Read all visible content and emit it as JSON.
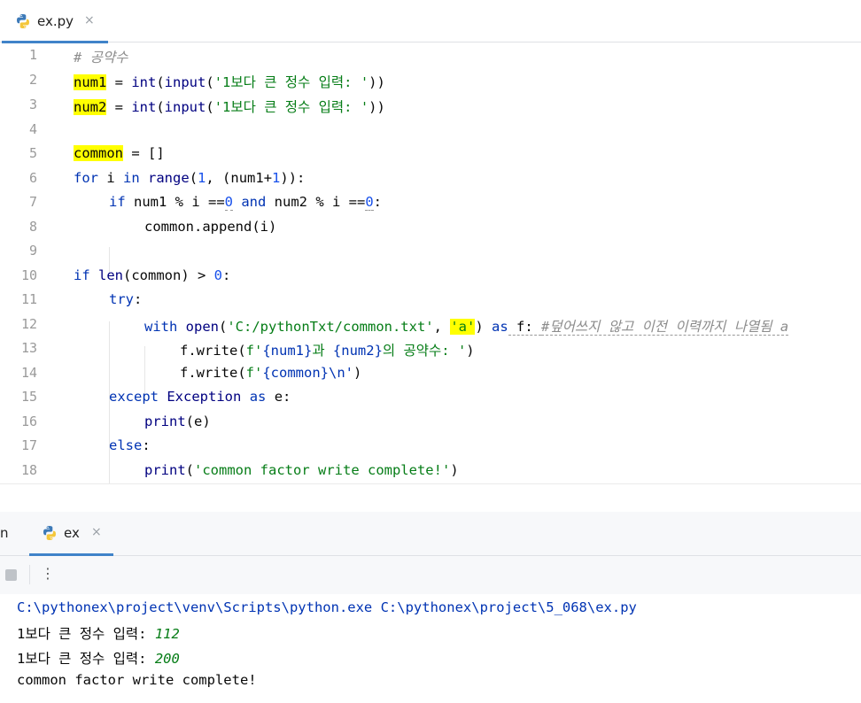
{
  "editor_tab": {
    "label": "ex.py",
    "close": "×",
    "icon": "python-file-icon"
  },
  "code_lines": [
    {
      "n": "1"
    },
    {
      "n": "2"
    },
    {
      "n": "3"
    },
    {
      "n": "4"
    },
    {
      "n": "5"
    },
    {
      "n": "6"
    },
    {
      "n": "7"
    },
    {
      "n": "8"
    },
    {
      "n": "9"
    },
    {
      "n": "10"
    },
    {
      "n": "11"
    },
    {
      "n": "12"
    },
    {
      "n": "13"
    },
    {
      "n": "14"
    },
    {
      "n": "15"
    },
    {
      "n": "16"
    },
    {
      "n": "17"
    },
    {
      "n": "18"
    }
  ],
  "code": {
    "l1": "# 공약수",
    "l2_var": "num1",
    "l2_rest_a": " = ",
    "l2_int": "int",
    "l2_p1": "(",
    "l2_input": "input",
    "l2_p2": "(",
    "l2_str": "'1보다 큰 정수 입력: '",
    "l2_p3": "))",
    "l3_var": "num2",
    "l3_rest_a": " = ",
    "l3_int": "int",
    "l3_p1": "(",
    "l3_input": "input",
    "l3_p2": "(",
    "l3_str": "'1보다 큰 정수 입력: '",
    "l3_p3": "))",
    "l5_var": "common",
    "l5_rest": " = []",
    "l6_for": "for",
    "l6_a": " i ",
    "l6_in": "in",
    "l6_sp": " ",
    "l6_range": "range",
    "l6_b": "(",
    "l6_n1": "1",
    "l6_c": ", (num1+",
    "l6_n2": "1",
    "l6_d": ")):",
    "l7_if": "if",
    "l7_a": " num1 % i ==",
    "l7_z1": "0",
    "l7_sp": " ",
    "l7_and": "and",
    "l7_b": " num2 % i ==",
    "l7_z2": "0",
    "l7_c": ":",
    "l8": "common.append(i)",
    "l10_if": "if",
    "l10_sp": " ",
    "l10_len": "len",
    "l10_a": "(common) > ",
    "l10_z": "0",
    "l10_b": ":",
    "l11_try": "try",
    "l11_b": ":",
    "l12_with": "with",
    "l12_sp": " ",
    "l12_open": "open",
    "l12_a": "(",
    "l12_path": "'C:/pythonTxt/common.txt'",
    "l12_b": ", ",
    "l12_mode": "'a'",
    "l12_c": ") ",
    "l12_as": "as",
    "l12_d": " f: ",
    "l12_cmt": "#덮어쓰지 않고 이전 이력까지 나열됨 a",
    "l13_a": "f.write(",
    "l13_f": "f'",
    "l13_b": "{num1}",
    "l13_s1": "과 ",
    "l13_c": "{num2}",
    "l13_s2": "의 공약수: '",
    "l13_d": ")",
    "l14_a": "f.write(",
    "l14_f": "f'",
    "l14_b": "{common}",
    "l14_s": "\\n'",
    "l14_c": ")",
    "l15_except": "except",
    "l15_sp": " ",
    "l15_exc": "Exception",
    "l15_sp2": " ",
    "l15_as": "as",
    "l15_b": " e:",
    "l16_print": "print",
    "l16_b": "(e)",
    "l17_else": "else",
    "l17_b": ":",
    "l18_print": "print",
    "l18_a": "(",
    "l18_str": "'common factor write complete!'",
    "l18_b": ")"
  },
  "run_panel": {
    "left_label": "n",
    "tab_label": "ex",
    "tab_close": "×",
    "more_label": "⋮"
  },
  "console": {
    "command": "C:\\pythonex\\project\\venv\\Scripts\\python.exe C:\\pythonex\\project\\5_068\\ex.py",
    "prompt1": "1보다 큰 정수 입력: ",
    "input1": "112",
    "prompt2": "1보다 큰 정수 입력: ",
    "input2": "200",
    "result": "common factor write complete!"
  },
  "colors": {
    "keyword": "#0033b3",
    "string": "#067d17",
    "number": "#1750eb",
    "comment": "#8c8c8c",
    "highlight": "#ffff00",
    "tab_accent": "#4083c9"
  }
}
